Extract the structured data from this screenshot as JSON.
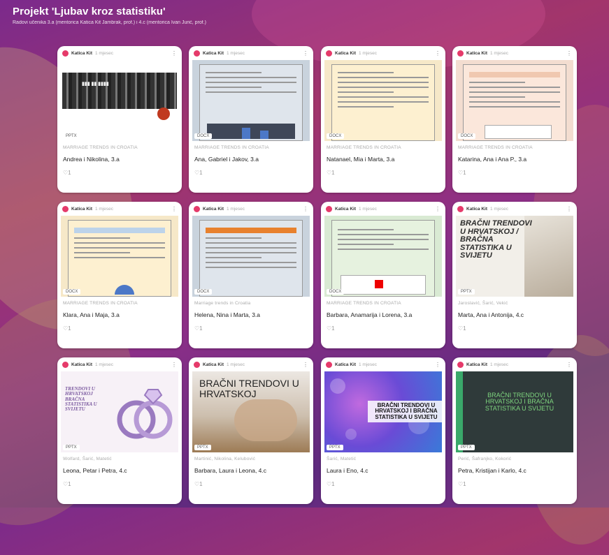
{
  "header": {
    "title": "Projekt 'Ljubav kroz statistiku'",
    "subtitle": "Radovi učenika 3.a (mentorica Katica Kit Jambrak, prof.) i 4.c (mentorica Ivan Jurić, prof.)"
  },
  "cards": [
    {
      "author": "Katica Kit",
      "time": "1 mjesec",
      "tag": "PPTX",
      "category": "MARRIAGE TRENDS IN CROATIA",
      "caption": "Andrea i Nikolina, 3.a",
      "likes": "1"
    },
    {
      "author": "Katica Kit",
      "time": "1 mjesec",
      "tag": "DOCX",
      "category": "MARRIAGE TRENDS IN CROATIA",
      "caption": "Ana, Gabriel i Jakov, 3.a",
      "likes": "1"
    },
    {
      "author": "Katica Kit",
      "time": "1 mjesec",
      "tag": "DOCX",
      "category": "MARRIAGE TRENDS IN CROATIA",
      "caption": "Natanael, Mia i Marta, 3.a",
      "likes": "1"
    },
    {
      "author": "Katica Kit",
      "time": "1 mjesec",
      "tag": "DOCX",
      "category": "MARRIAGE TRENDS IN CROATIA",
      "caption": "Katarina, Ana i Ana P., 3.a",
      "likes": "1"
    },
    {
      "author": "Katica Kit",
      "time": "1 mjesec",
      "tag": "DOCX",
      "category": "MARRIAGE TRENDS IN CROATIA",
      "caption": "Klara, Ana i Maja, 3.a",
      "likes": "1"
    },
    {
      "author": "Katica Kit",
      "time": "1 mjesec",
      "tag": "DOCX",
      "category": "Marriage trends in Croatia",
      "caption": "Helena, Nina i Marta, 3.a",
      "likes": "1"
    },
    {
      "author": "Katica Kit",
      "time": "1 mjesec",
      "tag": "DOCX",
      "category": "MARRIAGE TRENDS IN CROATIA",
      "caption": "Barbara, Anamarija i Lorena, 3.a",
      "likes": "1"
    },
    {
      "author": "Katica Kit",
      "time": "1 mjesec",
      "tag": "PPTX",
      "category": "Jaroslavić, Šarić, Vekić",
      "caption": "Marta, Ana i Antonija, 4.c",
      "likes": "1",
      "slide": "BRAČNI TRENDOVI U HRVATSKOJ / BRAČNA STATISTIKA U SVIJETU"
    },
    {
      "author": "Katica Kit",
      "time": "1 mjesec",
      "tag": "PPTX",
      "category": "Wolfard, Šarić, Matetić",
      "caption": "Leona, Petar i Petra, 4.c",
      "likes": "1",
      "slide": "TRENDOVI U HRVATSKOJ BRAČNA STATISTIKA U SVIJETU"
    },
    {
      "author": "Katica Kit",
      "time": "1 mjesec",
      "tag": "PPTX",
      "category": "Martinić, Nikolina, Kelubović",
      "caption": "Barbara, Laura i Leona, 4.c",
      "likes": "1",
      "slide": "BRAČNI TRENDOVI U HRVATSKOJ"
    },
    {
      "author": "Katica Kit",
      "time": "1 mjesec",
      "tag": "PPTX",
      "category": "Šarić, Matetić",
      "caption": "Laura i Eno, 4.c",
      "likes": "1",
      "slide": "BRAČNI TRENDOVI U HRVATSKOJ I BRAČNA STATISTIKA U SVIJETU"
    },
    {
      "author": "Katica Kit",
      "time": "1 mjesec",
      "tag": "PPTX",
      "category": "Perić, Šafranjko, Kokorić",
      "caption": "Petra, Kristijan i Karlo, 4.c",
      "likes": "1",
      "slide": "BRAČNI TRENDOVI U HRVATSKOJ I BRAČNA STATISTIKA U SVIJETU"
    }
  ]
}
